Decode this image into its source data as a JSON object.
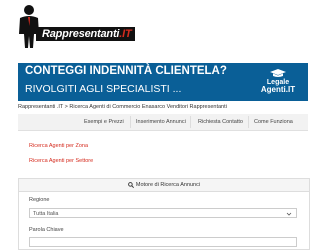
{
  "logo": {
    "text": "Rappresentanti",
    "suffix": ".IT"
  },
  "banner": {
    "headline": "CONTEGGI INDENNITÀ CLIENTELA?",
    "subline": "RIVOLGITI AGLI SPECIALISTI ...",
    "brand_line1": "Legale",
    "brand_line2": "Agenti.IT",
    "color": "#0a5f97"
  },
  "breadcrumb": {
    "text": "Rappresentanti .IT > Ricerca Agenti di Commercio Enasarco Venditori Rappresentanti"
  },
  "nav": {
    "items": [
      "Esempi e Prezzi",
      "Inserimento Annunci",
      "Richiesta Contatto",
      "Come Funziona"
    ]
  },
  "links": {
    "zona": "Ricerca Agenti per Zona",
    "settore": "Ricerca Agenti per Settore",
    "color": "#d52b1e"
  },
  "search": {
    "title": "Motore di Ricerca Annunci",
    "region_label": "Regione",
    "region_value": "Tutta Italia",
    "keyword_label": "Parola Chiave",
    "keyword_value": ""
  }
}
